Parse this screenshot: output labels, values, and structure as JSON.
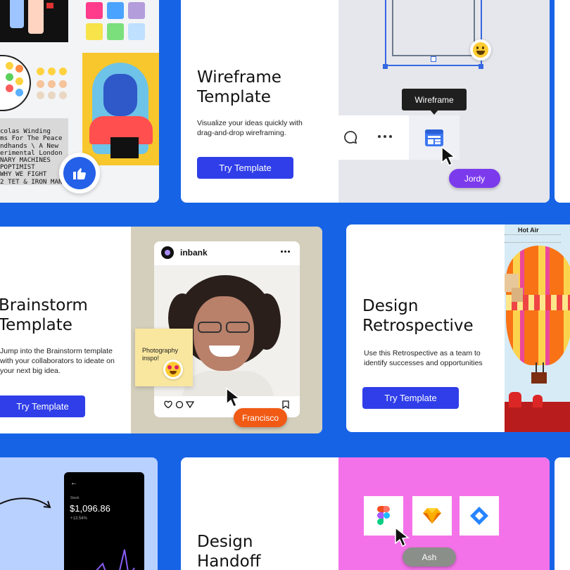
{
  "cards": {
    "wireframe": {
      "title_line1": "Wireframe",
      "title_line2": "Template",
      "description": "Visualize your ideas quickly with drag-and-drop wireframing.",
      "button": "Try Template",
      "tooltip": "Wireframe",
      "cursor_user": "Jordy"
    },
    "brainstorm": {
      "title_line1": "Brainstorm",
      "title_line2": "Template",
      "description": "Jump into the Brainstorm template with your collaborators to ideate on your next big idea.",
      "button": "Try Template",
      "post_account": "inbank",
      "sticky_note": "Photography inspo!",
      "cursor_user": "Francisco"
    },
    "retrospective": {
      "title_line1": "Design",
      "title_line2": "Retrospective",
      "description": "Use this Retrospective as a team to identify successes and opportunities",
      "button": "Try Template",
      "poster_title": "Hot Air"
    },
    "handoff": {
      "title_line1": "Design",
      "title_line2": "Handoff",
      "cursor_user": "Ash",
      "app_icons": [
        "figma-icon",
        "sketch-icon",
        "jira-icon"
      ]
    },
    "left_top": {
      "poster_text": [
        "colas Winding",
        "ms For The Peace",
        "ndhands \\ A New",
        "erimental London",
        "",
        "NARY MACHINES",
        "POPTIMIST",
        "WHY WE FIGHT",
        "2 TET & IRON MAN"
      ]
    },
    "left_bottom": {
      "stock_label": "Stock",
      "stock_value": "$1,096.86",
      "stock_change": "+13.54%"
    }
  },
  "colors": {
    "background": "#1663e6",
    "button": "#2f3ee8",
    "jordy": "#7c3aed",
    "francisco": "#f05a14",
    "ash": "#8a8f8a",
    "handoff_panel": "#f472e9"
  }
}
